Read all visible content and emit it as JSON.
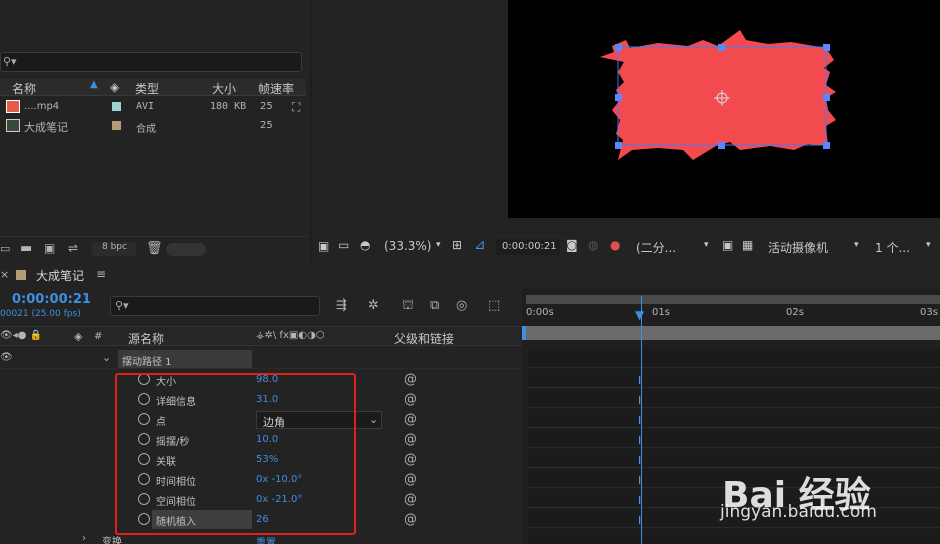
{
  "project": {
    "columns": {
      "name": "名称",
      "type": "类型",
      "size": "大小",
      "framerate": "帧速率"
    },
    "items": [
      {
        "name": "....mp4",
        "type": "AVI",
        "size": "180 KB",
        "framerate": "25",
        "label_color": "#9fd1d1"
      },
      {
        "name": "大成笔记",
        "type": "合成",
        "size": "",
        "framerate": "25",
        "label_color": "#b39b77"
      }
    ],
    "bpc": "8 bpc"
  },
  "viewer": {
    "zoom": "(33.3%)",
    "timecode": "0:00:00:21",
    "resolution": "(二分...",
    "camera": "活动摄像机",
    "views": "1 个...",
    "shape_color": "#f24a4f"
  },
  "timeline": {
    "comp_name": "大成笔记",
    "timecode": "0:00:00:21",
    "frame_info": "00021 (25.00 fps)",
    "source_name_header": "源名称",
    "parent_header": "父级和链接",
    "effect_name": "摆动路径 1",
    "ruler": [
      "0:00s",
      "01s",
      "02s",
      "03s"
    ],
    "properties": [
      {
        "name": "大小",
        "value": "98.0"
      },
      {
        "name": "详细信息",
        "value": "31.0"
      },
      {
        "name": "点",
        "value": "边角"
      },
      {
        "name": "摇摆/秒",
        "value": "10.0"
      },
      {
        "name": "关联",
        "value": "53%"
      },
      {
        "name": "时间相位",
        "value": "0x -10.0°"
      },
      {
        "name": "空间相位",
        "value": "0x -21.0°"
      },
      {
        "name": "随机植入",
        "value": "26"
      }
    ],
    "transform_label": "变换",
    "transform_value": "重置"
  },
  "watermark": {
    "brand": "Bai 经验",
    "url": "jingyan.baidu.com"
  }
}
